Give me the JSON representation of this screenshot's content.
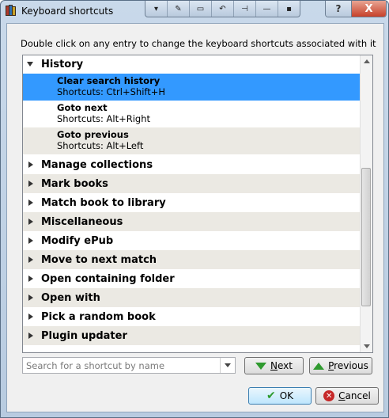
{
  "window": {
    "title": "Keyboard shortcuts",
    "toolbar_icons": [
      "collapse-icon",
      "wrench-icon",
      "window-icon",
      "undo-icon",
      "pin-icon",
      "minimize-icon",
      "restore-icon"
    ],
    "help_label": "?",
    "close_label": "X"
  },
  "hint": "Double click on any entry to change the keyboard shortcuts associated with it",
  "tree": {
    "expanded_category": "History",
    "shortcuts": [
      {
        "name": "Clear search history",
        "keys": "Shortcuts: Ctrl+Shift+H",
        "selected": true
      },
      {
        "name": "Goto next",
        "keys": "Shortcuts: Alt+Right",
        "selected": false
      },
      {
        "name": "Goto previous",
        "keys": "Shortcuts: Alt+Left",
        "selected": false
      }
    ],
    "categories": [
      "Manage collections",
      "Mark books",
      "Match book to library",
      "Miscellaneous",
      "Modify ePub",
      "Move to next match",
      "Open containing folder",
      "Open with",
      "Pick a random book",
      "Plugin updater"
    ]
  },
  "search": {
    "placeholder": "Search for a shortcut by name"
  },
  "buttons": {
    "next_pre": "",
    "next_underlined": "N",
    "next_rest": "ext",
    "prev_pre": "",
    "prev_underlined": "P",
    "prev_rest": "revious",
    "ok": "OK",
    "cancel_underlined": "C",
    "cancel_rest": "ancel"
  },
  "colors": {
    "selection": "#3399ff",
    "alt_row": "#ebe9e3",
    "arrow_green": "#2f9a2f",
    "cancel_red": "#c62828"
  }
}
